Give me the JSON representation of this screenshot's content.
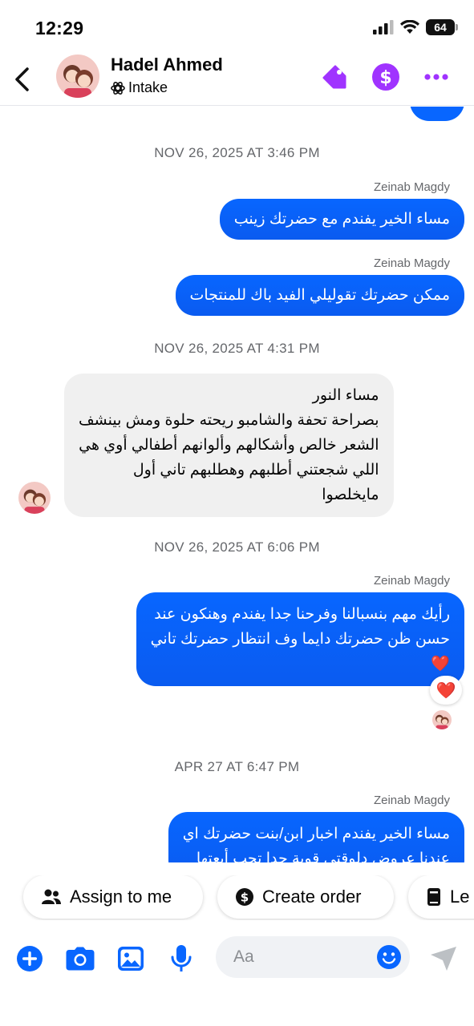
{
  "status": {
    "time": "12:29",
    "battery": "64"
  },
  "header": {
    "contact_name": "Hadel Ahmed",
    "label": "Intake",
    "icons": [
      "back-icon",
      "tag-icon",
      "dollar-icon",
      "more-icon"
    ]
  },
  "messages": [
    {
      "type": "timestamp",
      "text": "NOV 26, 2025 AT 3:46 PM"
    },
    {
      "type": "outgoing",
      "sender": "Zeinab Magdy",
      "lines": [
        "مساء الخير يفندم مع حضرتك زينب"
      ]
    },
    {
      "type": "outgoing",
      "sender": "Zeinab Magdy",
      "lines": [
        "ممكن حضرتك تقوليلي الفيد باك للمنتجات"
      ]
    },
    {
      "type": "timestamp",
      "text": "NOV 26, 2025 AT 4:31 PM"
    },
    {
      "type": "incoming",
      "lines": [
        "مساء النور",
        "بصراحة تحفة والشامبو ريحته حلوة ومش بينشف",
        "الشعر خالص وأشكالهم وألوانهم أطفالي أوي هي",
        "اللي شجعتني أطلبهم وهطلبهم تاني أول",
        "مايخلصوا"
      ]
    },
    {
      "type": "timestamp",
      "text": "NOV 26, 2025 AT 6:06 PM"
    },
    {
      "type": "outgoing",
      "sender": "Zeinab Magdy",
      "lines": [
        "رأيك مهم بنسبالنا وفرحنا جدا يفندم وهنكون عند",
        "حسن ظن حضرتك دايما وف انتظار حضرتك تاني",
        "❤️"
      ],
      "reaction": "❤️"
    },
    {
      "type": "timestamp",
      "text": "APR 27 AT 6:47 PM"
    },
    {
      "type": "outgoing",
      "sender": "Zeinab Magdy",
      "lines": [
        "مساء الخير يفندم اخبار ابن/بنت حضرتك اي",
        "عندنا عروض دلوقتي قوية جدا تحب أبعتها"
      ]
    }
  ],
  "quick_actions": [
    {
      "label": "Assign to me",
      "icon": "people-icon"
    },
    {
      "label": "Create order",
      "icon": "dollar-circle-icon"
    },
    {
      "label": "Le",
      "icon": "book-icon"
    }
  ],
  "composer": {
    "placeholder": "Aa"
  },
  "colors": {
    "accent": "#0866ff",
    "purple": "#a033ff",
    "bubble_in": "#f0f0f0",
    "meta_text": "#65676b"
  }
}
